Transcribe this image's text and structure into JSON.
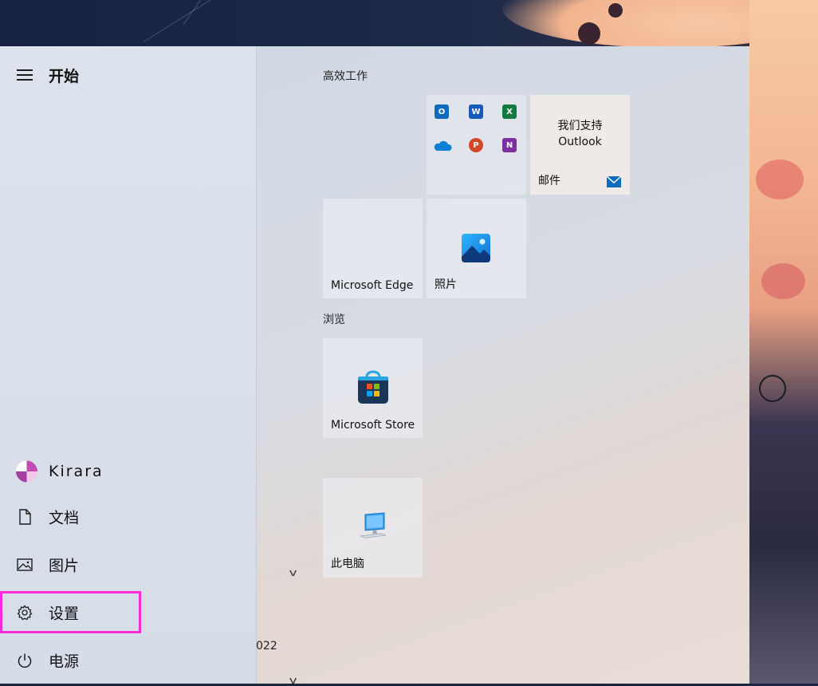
{
  "start_menu": {
    "title": "开始",
    "user": {
      "name": "Kirara"
    },
    "nav": [
      {
        "label": "文档",
        "icon": "document-icon"
      },
      {
        "label": "图片",
        "icon": "pictures-icon"
      },
      {
        "label": "设置",
        "icon": "gear-icon"
      },
      {
        "label": "电源",
        "icon": "power-icon"
      }
    ],
    "list_fragment": "022",
    "highlight_color": "#ff2bd6"
  },
  "groups": [
    {
      "label": "高效工作"
    },
    {
      "label": "浏览"
    }
  ],
  "tiles": {
    "office_apps": [
      "outlook-icon",
      "word-icon",
      "excel-icon",
      "onedrive-icon",
      "powerpoint-icon",
      "onenote-icon"
    ],
    "mail": {
      "message": "我们支持 Outlook",
      "line1": "我们支持",
      "line2": "Outlook",
      "label": "邮件"
    },
    "edge": {
      "label": "Microsoft Edge"
    },
    "photos": {
      "label": "照片"
    },
    "store": {
      "label": "Microsoft Store"
    },
    "this_pc": {
      "label": "此电脑"
    }
  }
}
